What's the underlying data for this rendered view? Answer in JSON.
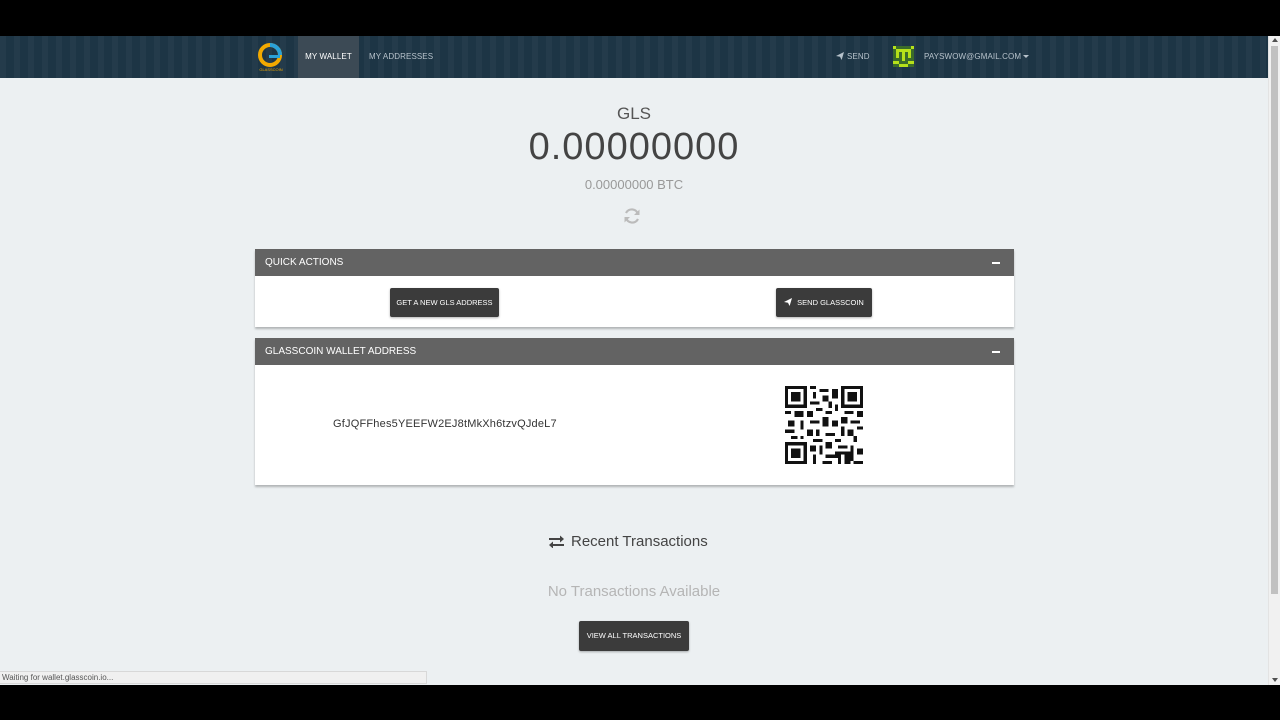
{
  "nav": {
    "my_wallet": "MY WALLET",
    "my_addresses": "MY ADDRESSES",
    "send": "SEND",
    "user_email": "PAYSWOW@GMAIL.COM",
    "logo_text": "GLASSCOIN"
  },
  "balance": {
    "currency": "GLS",
    "amount": "0.00000000",
    "btc_value": "0.00000000 BTC"
  },
  "quick_actions": {
    "title": "QUICK ACTIONS",
    "new_address_label": "GET A NEW GLS ADDRESS",
    "send_label": "SEND GLASSCOIN"
  },
  "wallet_address_panel": {
    "title": "GLASSCOIN WALLET ADDRESS",
    "address": "GfJQFFhes5YEEFW2EJ8tMkXh6tzvQJdeL7"
  },
  "transactions": {
    "title": "Recent Transactions",
    "empty_message": "No Transactions Available",
    "view_all_label": "VIEW ALL TRANSACTIONS"
  },
  "status_bar": "Waiting for wallet.glasscoin.io...",
  "icons": [
    "glasscoin-logo",
    "send-plane-icon",
    "avatar",
    "refresh-icon",
    "collapse-icon",
    "qr-code",
    "exchange-arrows-icon"
  ],
  "colors": {
    "navbar": "#1d3545",
    "panel_header": "#636363",
    "button": "#3b3b3b",
    "page_bg": "#ecf0f2"
  }
}
